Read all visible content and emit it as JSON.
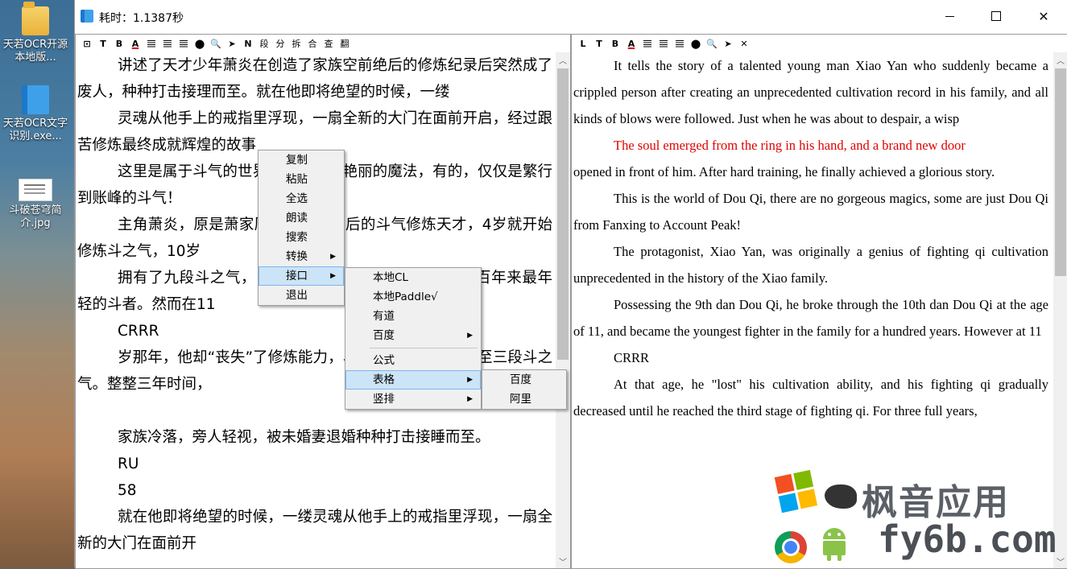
{
  "desktop": {
    "icons": [
      {
        "label": "天若OCR开源本地版...",
        "icon": "folder-icon"
      },
      {
        "label": "天若OCR文字识别.exe...",
        "icon": "app-book-icon"
      },
      {
        "label": "斗破苍穹简介.jpg",
        "icon": "image-file-icon"
      }
    ]
  },
  "window": {
    "title": "耗时：1.1387秒",
    "controls": {
      "close": "✕"
    }
  },
  "left_toolbar": [
    "⊡",
    "T",
    "B",
    "A",
    "≡",
    "≡",
    "≡",
    "⬤",
    "🔍",
    "➤",
    "N",
    "段",
    "分",
    "拆",
    "合",
    "查",
    "翻"
  ],
  "right_toolbar": [
    "L",
    "T",
    "B",
    "A",
    "≡",
    "≡",
    "≡",
    "⬤",
    "🔍",
    "➤",
    "✕"
  ],
  "left_text": [
    {
      "text": "讲述了天才少年萧炎在创造了家族空前绝后的修炼纪录后突然成了废人，种种打击接理而至。就在他即将绝望的时候，一缕",
      "indent": true
    },
    {
      "text": "灵魂从他手上的戒指里浮现，一扇全新的大门在面前开启，经过跟苦修炼最终成就辉煌的故事",
      "indent": true
    },
    {
      "text": "这里是属于斗气的世界，没有花俏艳丽的魔法，有的，仅仅是繁行到账峰的斗气！",
      "indent": true
    },
    {
      "text": "主角萧炎，原是萧家历史上空前绝后的斗气修炼天才，4岁就开始修炼斗之气，10岁",
      "indent": true
    },
    {
      "text": "拥有了九段斗之气，11岁突破十段斗之气，成为家族百年来最年轻的斗者。然而在11",
      "indent": true
    },
    {
      "text": "CRRR",
      "indent": true
    },
    {
      "text": "岁那年，他却“丧失”了修炼能力，斗之气逐渐减少，直至三段斗之气。整整三年时间，",
      "indent": true
    },
    {
      "text": "",
      "indent": false
    },
    {
      "text": "家族冷落，旁人轻视，被未婚妻退婚种种打击接睡而至。",
      "indent": true
    },
    {
      "text": "RU",
      "indent": true
    },
    {
      "text": "58",
      "indent": true
    },
    {
      "text": "就在他即将绝望的时候，一缕灵魂从他手上的戒指里浮现，一扇全新的大门在面前开",
      "indent": true
    }
  ],
  "right_text": [
    {
      "text": "It tells the story of a talented young man Xiao Yan who suddenly became a crippled person after creating an unprecedented cultivation record in his family, and all kinds of blows were followed. Just when he was about to despair, a wisp",
      "indent": true,
      "highlight": false
    },
    {
      "text": "The soul emerged from the ring in his hand, and a brand new door",
      "indent": true,
      "highlight": true
    },
    {
      "text": "opened in front of him. After hard training, he finally achieved a glorious story.",
      "indent": false,
      "highlight": false
    },
    {
      "text": "This is the world of Dou Qi, there are no gorgeous magics, some are just Dou Qi from Fanxing to Account Peak!",
      "indent": true,
      "highlight": false
    },
    {
      "text": "The protagonist, Xiao Yan, was originally a genius of fighting qi cultivation unprecedented in the history of the Xiao family.",
      "indent": true,
      "highlight": false
    },
    {
      "text": "Possessing the 9th dan Dou Qi, he broke through the 10th dan Dou Qi at the age of 11, and became the youngest fighter in the family for a hundred years. However at 11",
      "indent": true,
      "highlight": false
    },
    {
      "text": "CRRR",
      "indent": true,
      "highlight": false
    },
    {
      "text": "At that age, he \"lost\" his cultivation ability, and his fighting qi gradually decreased until he reached the third stage of fighting qi. For three full years,",
      "indent": true,
      "highlight": false
    }
  ],
  "context_menu": {
    "items": [
      {
        "label": "复制",
        "submenu": false
      },
      {
        "label": "粘贴",
        "submenu": false
      },
      {
        "label": "全选",
        "submenu": false
      },
      {
        "label": "朗读",
        "submenu": false
      },
      {
        "label": "搜索",
        "submenu": false
      },
      {
        "label": "转换",
        "submenu": true
      },
      {
        "label": "接口",
        "submenu": true,
        "active": true
      },
      {
        "label": "退出",
        "submenu": false
      }
    ]
  },
  "interface_submenu": {
    "items": [
      {
        "label": "本地CL",
        "submenu": false
      },
      {
        "label": "本地Paddle√",
        "submenu": false
      },
      {
        "label": "有道",
        "submenu": false
      },
      {
        "label": "百度",
        "submenu": true
      },
      {
        "label": "---"
      },
      {
        "label": "公式",
        "submenu": false
      },
      {
        "label": "表格",
        "submenu": true,
        "active": true
      },
      {
        "label": "竖排",
        "submenu": true
      }
    ]
  },
  "table_submenu": {
    "items": [
      {
        "label": "百度"
      },
      {
        "label": "阿里"
      }
    ]
  },
  "watermark": {
    "line1": "枫音应用",
    "line2": "fy6b.com"
  }
}
